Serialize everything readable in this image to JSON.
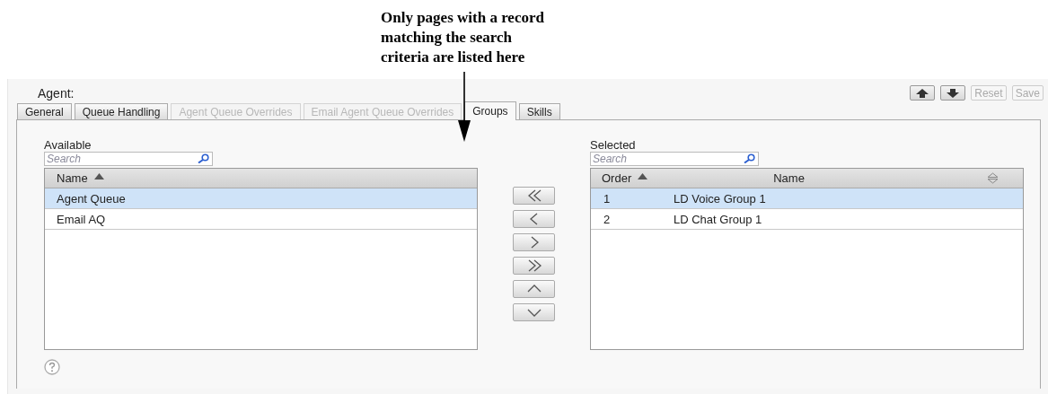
{
  "callout": {
    "text": "Only pages with a record\nmatching the search\ncriteria are listed here"
  },
  "header": {
    "label": "Agent:"
  },
  "toolbar": [
    {
      "kind": "up",
      "disabled": false
    },
    {
      "kind": "down",
      "disabled": false
    },
    {
      "kind": "text",
      "label": "Reset",
      "disabled": true
    },
    {
      "kind": "text",
      "label": "Save",
      "disabled": true
    }
  ],
  "tabs": [
    {
      "label": "General",
      "selected": false,
      "disabled": false
    },
    {
      "label": "Queue Handling",
      "selected": false,
      "disabled": false
    },
    {
      "label": "Agent Queue Overrides",
      "selected": false,
      "disabled": true
    },
    {
      "label": "Email Agent Queue Overrides",
      "selected": false,
      "disabled": true
    },
    {
      "label": "Groups",
      "selected": true,
      "disabled": false
    },
    {
      "label": "Skills",
      "selected": false,
      "disabled": false
    }
  ],
  "available": {
    "title": "Available",
    "search": {
      "placeholder": "Search"
    },
    "columns": [
      "Name"
    ],
    "rows": [
      {
        "cells": [
          "Agent Queue"
        ],
        "selected": true
      },
      {
        "cells": [
          "Email AQ"
        ],
        "selected": false
      }
    ]
  },
  "move_buttons": [
    {
      "kind": "all-left"
    },
    {
      "kind": "left"
    },
    {
      "kind": "right"
    },
    {
      "kind": "all-right"
    },
    {
      "kind": "up"
    },
    {
      "kind": "down"
    }
  ],
  "selected_list": {
    "title": "Selected",
    "search": {
      "placeholder": "Search"
    },
    "columns": [
      "Order",
      "Name"
    ],
    "rows": [
      {
        "cells": [
          "1",
          "LD Voice Group 1"
        ],
        "selected": true
      },
      {
        "cells": [
          "2",
          "LD Chat Group 1"
        ],
        "selected": false
      }
    ]
  }
}
